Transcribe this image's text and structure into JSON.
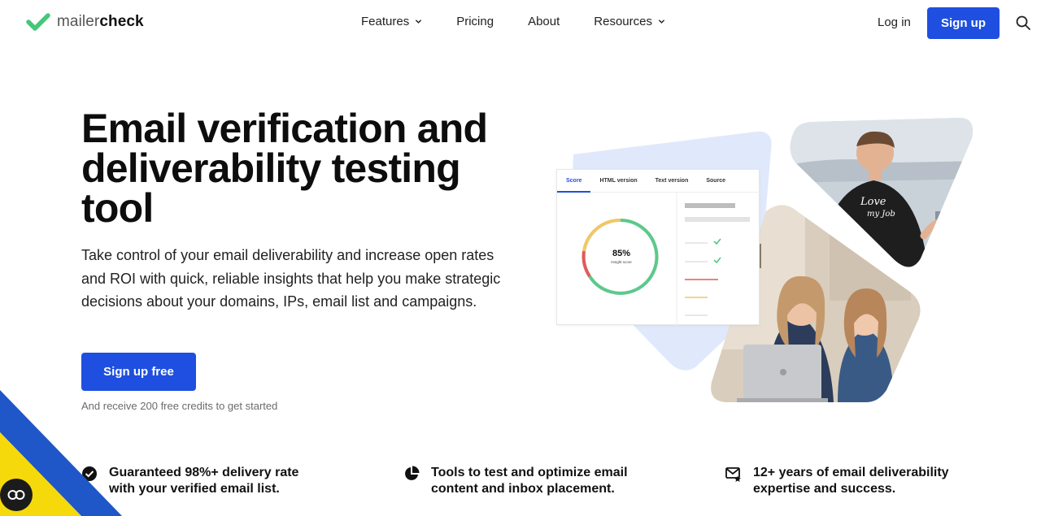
{
  "brand": {
    "name_light": "mailer",
    "name_bold": "check",
    "accent": "#1f4fe0",
    "logo_green": "#45c779"
  },
  "nav": {
    "items": [
      {
        "label": "Features",
        "has_dropdown": true
      },
      {
        "label": "Pricing",
        "has_dropdown": false
      },
      {
        "label": "About",
        "has_dropdown": false
      },
      {
        "label": "Resources",
        "has_dropdown": true
      }
    ],
    "login": "Log in",
    "signup": "Sign up",
    "search_icon": "search-icon"
  },
  "hero": {
    "title": "Email verification and deliverability testing tool",
    "description": "Take control of your email deliverability and increase open rates and ROI with quick, reliable insights that help you make strategic decisions about your domains, IPs, email list and campaigns.",
    "cta": "Sign up free",
    "cta_note": "And receive 200 free credits to get started"
  },
  "preview": {
    "tabs": [
      "Score",
      "HTML version",
      "Text version",
      "Source"
    ],
    "active_tab": "Score",
    "score": "85%",
    "score_label": "Insight score"
  },
  "features": [
    {
      "icon": "check-circle-icon",
      "text": "Guaranteed 98%+ delivery rate with your verified email list."
    },
    {
      "icon": "pie-chart-icon",
      "text": "Tools to test and optimize email content and inbox placement."
    },
    {
      "icon": "mail-star-icon",
      "text": "12+ years of email deliverability expertise and success."
    }
  ],
  "accessibility_fab": {
    "icon": "accessibility-icon"
  }
}
